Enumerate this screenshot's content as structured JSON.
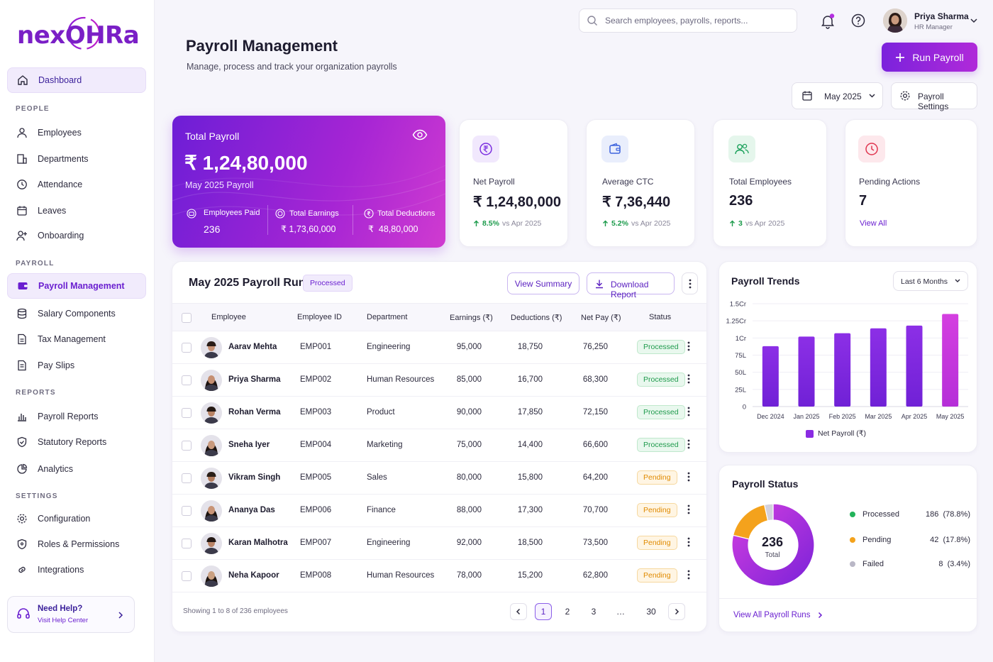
{
  "app": {
    "logo": "nexOHRa"
  },
  "sidebar": {
    "dashboard": "Dashboard",
    "sections": {
      "people": "PEOPLE",
      "payroll": "PAYROLL",
      "reports": "REPORTS",
      "settings": "SETTINGS"
    },
    "people_items": [
      "Employees",
      "Departments",
      "Attendance",
      "Leaves",
      "Onboarding"
    ],
    "payroll_items": [
      "Payroll Management",
      "Salary Components",
      "Tax Management",
      "Pay Slips"
    ],
    "reports_items": [
      "Payroll Reports",
      "Statutory Reports",
      "Analytics"
    ],
    "settings_items": [
      "Configuration",
      "Roles & Permissions",
      "Integrations"
    ],
    "help": {
      "title": "Need Help?",
      "sub": "Visit Help Center"
    }
  },
  "header": {
    "search_placeholder": "Search employees, payrolls, reports...",
    "user_name": "Priya Sharma",
    "user_role": "HR Manager"
  },
  "page": {
    "title": "Payroll Management",
    "subtitle": "Manage, process and track your organization payrolls",
    "run_payroll": "Run Payroll",
    "period": "May 2025",
    "settings_btn": "Payroll Settings"
  },
  "total_card": {
    "label": "Total Payroll",
    "value": "₹ 1,24,80,000",
    "sub": "May 2025 Payroll",
    "employees_paid_label": "Employees Paid",
    "employees_paid": "236",
    "earnings_label": "Total Earnings",
    "earnings": "₹ 1,73,60,000",
    "deductions_label": "Total Deductions",
    "deductions": "₹  48,80,000"
  },
  "stats": [
    {
      "label": "Net Payroll",
      "value": "₹ 1,24,80,000",
      "trend": "8.5%",
      "trend_text": "vs Apr 2025",
      "icon": "rupee-icon",
      "color": "#7b2fe0"
    },
    {
      "label": "Average CTC",
      "value": "₹ 7,36,440",
      "trend": "5.2%",
      "trend_text": "vs Apr 2025",
      "icon": "wallet-icon",
      "color": "#3d63dd"
    },
    {
      "label": "Total Employees",
      "value": "236",
      "trend": "3",
      "trend_text": "vs Apr 2025",
      "icon": "users-icon",
      "color": "#1aa05a"
    },
    {
      "label": "Pending Actions",
      "value": "7",
      "link": "View All",
      "icon": "clock-icon",
      "color": "#e0354f"
    }
  ],
  "run": {
    "title": "May 2025 Payroll Run",
    "badge": "Processed",
    "view_summary": "View Summary",
    "download": "Download Report",
    "columns": [
      "Employee",
      "Employee ID",
      "Department",
      "Earnings (₹)",
      "Deductions (₹)",
      "Net Pay (₹)",
      "Status"
    ],
    "rows": [
      {
        "name": "Aarav Mehta",
        "id": "EMP001",
        "dept": "Engineering",
        "earn": "95,000",
        "ded": "18,750",
        "net": "76,250",
        "status": "Processed"
      },
      {
        "name": "Priya Sharma",
        "id": "EMP002",
        "dept": "Human Resources",
        "earn": "85,000",
        "ded": "16,700",
        "net": "68,300",
        "status": "Processed"
      },
      {
        "name": "Rohan Verma",
        "id": "EMP003",
        "dept": "Product",
        "earn": "90,000",
        "ded": "17,850",
        "net": "72,150",
        "status": "Processed"
      },
      {
        "name": "Sneha Iyer",
        "id": "EMP004",
        "dept": "Marketing",
        "earn": "75,000",
        "ded": "14,400",
        "net": "66,600",
        "status": "Processed"
      },
      {
        "name": "Vikram Singh",
        "id": "EMP005",
        "dept": "Sales",
        "earn": "80,000",
        "ded": "15,800",
        "net": "64,200",
        "status": "Pending"
      },
      {
        "name": "Ananya Das",
        "id": "EMP006",
        "dept": "Finance",
        "earn": "88,000",
        "ded": "17,300",
        "net": "70,700",
        "status": "Pending"
      },
      {
        "name": "Karan Malhotra",
        "id": "EMP007",
        "dept": "Engineering",
        "earn": "92,000",
        "ded": "18,500",
        "net": "73,500",
        "status": "Pending"
      },
      {
        "name": "Neha Kapoor",
        "id": "EMP008",
        "dept": "Human Resources",
        "earn": "78,000",
        "ded": "15,200",
        "net": "62,800",
        "status": "Pending"
      }
    ],
    "showing": "Showing 1 to 8 of 236 employees",
    "pages": [
      "1",
      "2",
      "3",
      "…",
      "30"
    ]
  },
  "trends": {
    "title": "Payroll Trends",
    "range": "Last 6 Months",
    "legend": "Net Payroll (₹)"
  },
  "chart_data": {
    "type": "bar",
    "categories": [
      "Dec 2024",
      "Jan 2025",
      "Feb 2025",
      "Mar 2025",
      "Apr 2025",
      "May 2025"
    ],
    "y_ticks": [
      "0",
      "25L",
      "50L",
      "75L",
      "1Cr",
      "1.25Cr",
      "1.5Cr"
    ],
    "ylim": [
      0,
      150
    ],
    "series": [
      {
        "name": "Net Payroll (₹)",
        "values": [
          88,
          102,
          107,
          114,
          118,
          135
        ]
      }
    ]
  },
  "status": {
    "title": "Payroll Status",
    "center_value": "236",
    "center_label": "Total",
    "items": [
      {
        "label": "Processed",
        "count": "186",
        "pct": "(78.8%)",
        "value": 78.8,
        "color": "#b42ee0"
      },
      {
        "label": "Pending",
        "count": "42",
        "pct": "(17.8%)",
        "value": 17.8,
        "color": "#f4a21c"
      },
      {
        "label": "Failed",
        "count": "8",
        "pct": "(3.4%)",
        "value": 3.4,
        "color": "#b9b7c6"
      }
    ],
    "link": "View All Payroll Runs"
  }
}
